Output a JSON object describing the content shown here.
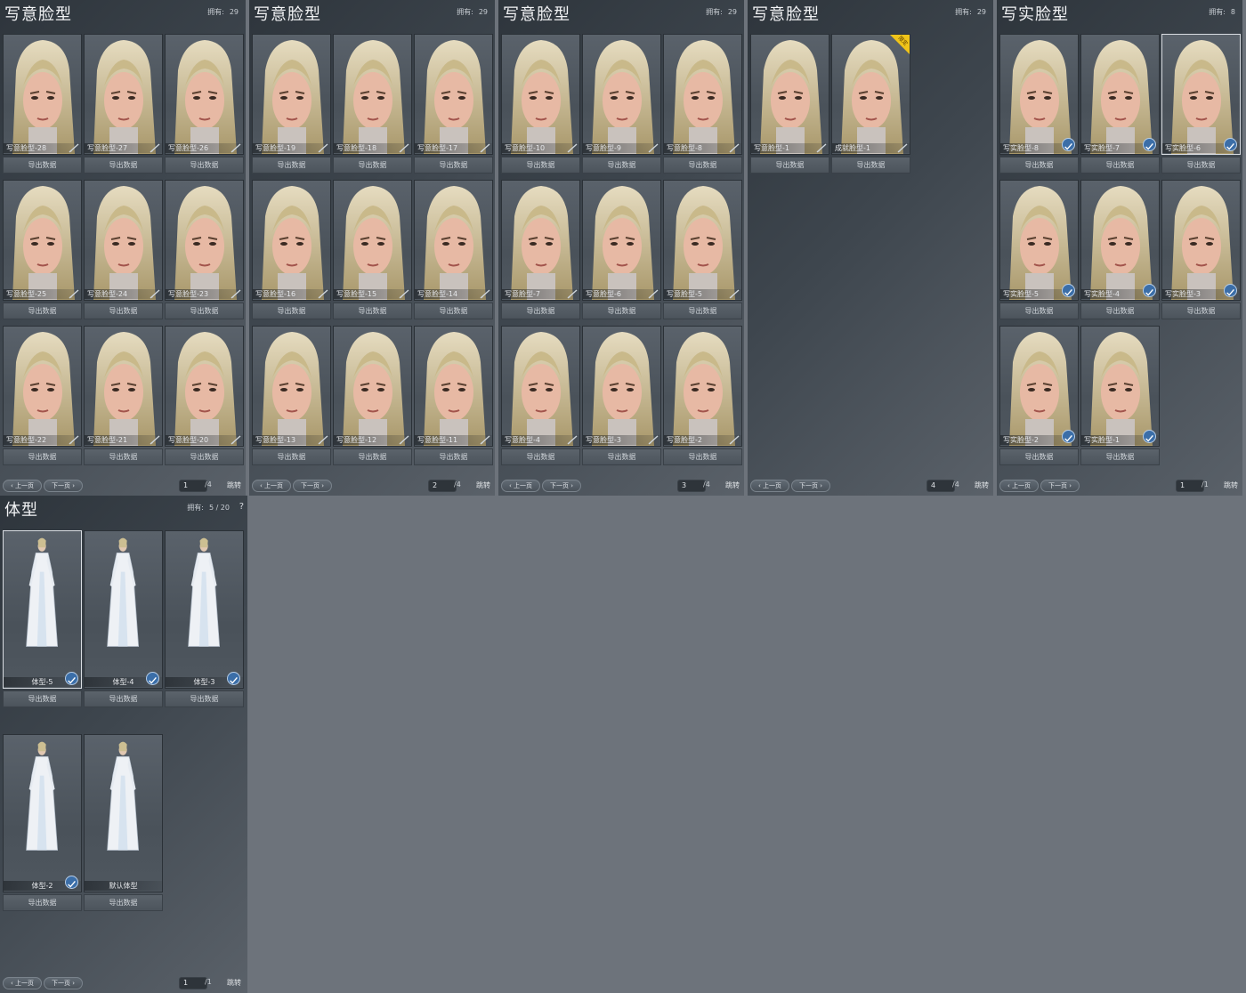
{
  "panels": [
    {
      "title": "写意脸型",
      "owned_label": "拥有:",
      "owned_value": "29",
      "cards": [
        {
          "label": "写意脸型-28"
        },
        {
          "label": "写意脸型-27"
        },
        {
          "label": "写意脸型-26"
        },
        {
          "label": "写意脸型-25"
        },
        {
          "label": "写意脸型-24"
        },
        {
          "label": "写意脸型-23"
        },
        {
          "label": "写意脸型-22"
        },
        {
          "label": "写意脸型-21"
        },
        {
          "label": "写意脸型-20"
        }
      ],
      "page": "1",
      "total": "/4"
    },
    {
      "title": "写意脸型",
      "owned_label": "拥有:",
      "owned_value": "29",
      "cards": [
        {
          "label": "写意脸型-19"
        },
        {
          "label": "写意脸型-18"
        },
        {
          "label": "写意脸型-17"
        },
        {
          "label": "写意脸型-16"
        },
        {
          "label": "写意脸型-15"
        },
        {
          "label": "写意脸型-14"
        },
        {
          "label": "写意脸型-13"
        },
        {
          "label": "写意脸型-12"
        },
        {
          "label": "写意脸型-11"
        }
      ],
      "page": "2",
      "total": "/4"
    },
    {
      "title": "写意脸型",
      "owned_label": "拥有:",
      "owned_value": "29",
      "cards": [
        {
          "label": "写意脸型-10"
        },
        {
          "label": "写意脸型-9"
        },
        {
          "label": "写意脸型-8"
        },
        {
          "label": "写意脸型-7"
        },
        {
          "label": "写意脸型-6"
        },
        {
          "label": "写意脸型-5"
        },
        {
          "label": "写意脸型-4"
        },
        {
          "label": "写意脸型-3"
        },
        {
          "label": "写意脸型-2"
        }
      ],
      "page": "3",
      "total": "/4"
    },
    {
      "title": "写意脸型",
      "owned_label": "拥有:",
      "owned_value": "29",
      "cards": [
        {
          "label": "写意脸型-1"
        },
        {
          "label": "成就脸型-1",
          "badge": "限定"
        }
      ],
      "page": "4",
      "total": "/4"
    },
    {
      "title": "写实脸型",
      "owned_label": "拥有:",
      "owned_value": "8",
      "cards": [
        {
          "label": "写实脸型-8"
        },
        {
          "label": "写实脸型-7"
        },
        {
          "label": "写实脸型-6"
        },
        {
          "label": "写实脸型-5"
        },
        {
          "label": "写实脸型-4"
        },
        {
          "label": "写实脸型-3"
        },
        {
          "label": "写实脸型-2"
        },
        {
          "label": "写实脸型-1"
        }
      ],
      "page": "1",
      "total": "/1"
    }
  ],
  "body_panel": {
    "title": "体型",
    "owned_label": "拥有:",
    "owned_value": "5 / 20",
    "help": "?",
    "cards": [
      {
        "label": "体型-5"
      },
      {
        "label": "体型-4"
      },
      {
        "label": "体型-3"
      },
      {
        "label": "体型-2"
      },
      {
        "label": "默认体型"
      }
    ],
    "page": "1",
    "total": "/1"
  },
  "export_label": "导出数据",
  "prev_label": "上一页",
  "next_label": "下一页",
  "go_label": "跳转",
  "icons": {
    "edit": "edit-pencil-icon",
    "equipped": "equipped-check-icon",
    "prev": "chevron-left-icon",
    "next": "chevron-right-icon"
  },
  "colors": {
    "badge": "#f0c419",
    "equipped": "#3b6ea8",
    "hair": "#c9b98a",
    "skin": "#e7b9a4"
  }
}
